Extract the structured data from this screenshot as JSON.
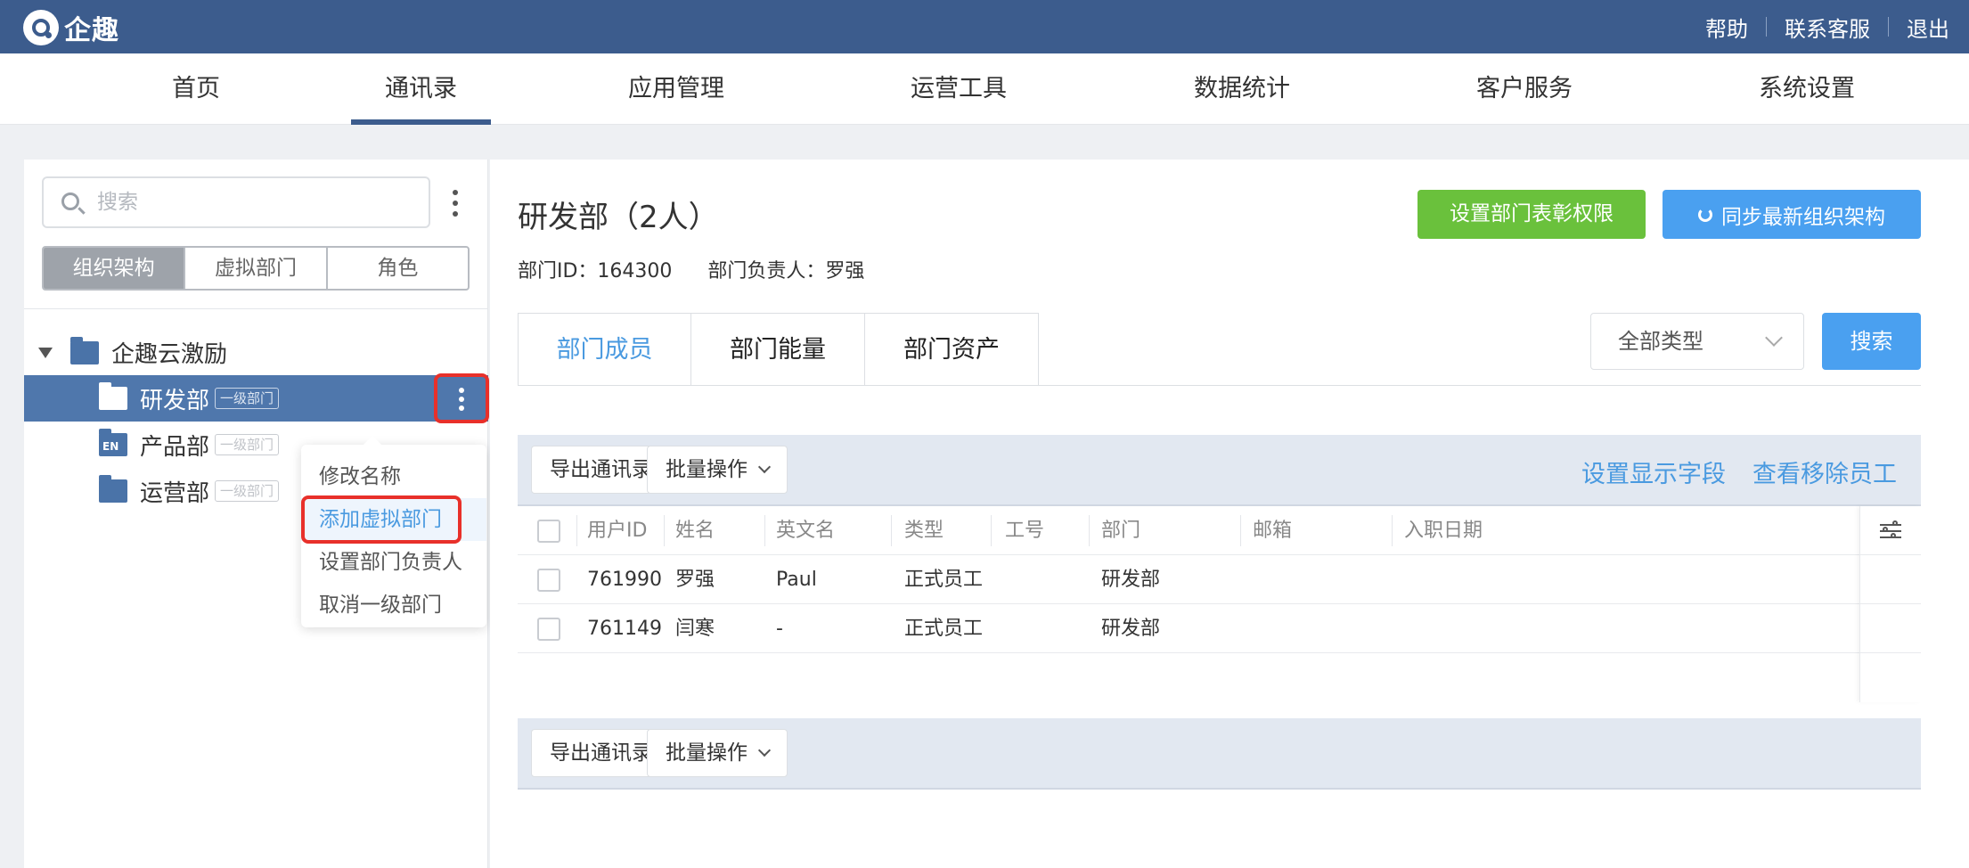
{
  "header": {
    "logo_text": "企趣",
    "links": [
      "帮助",
      "联系客服",
      "退出"
    ]
  },
  "nav": {
    "items": [
      "首页",
      "通讯录",
      "应用管理",
      "运营工具",
      "数据统计",
      "客户服务",
      "系统设置"
    ],
    "active": "通讯录"
  },
  "sidebar": {
    "search_placeholder": "搜索",
    "segments": [
      "组织架构",
      "虚拟部门",
      "角色"
    ],
    "active_segment": "组织架构",
    "tree": {
      "root": "企趣云激励",
      "children": [
        {
          "label": "研发部",
          "tag": "一级部门",
          "selected": true
        },
        {
          "label": "产品部",
          "tag": "一级部门",
          "icon": "EN"
        },
        {
          "label": "运营部",
          "tag": "一级部门"
        }
      ]
    },
    "context_menu": [
      "修改名称",
      "添加虚拟部门",
      "设置部门负责人",
      "取消一级部门"
    ],
    "context_menu_highlight": "添加虚拟部门"
  },
  "main": {
    "title": "研发部（2人）",
    "dept_id": "部门ID：164300",
    "manager": "部门负责人：罗强",
    "btn_reward": "设置部门表彰权限",
    "btn_sync": "同步最新组织架构",
    "tabs": [
      "部门成员",
      "部门能量",
      "部门资产"
    ],
    "type_select": "全部类型",
    "search_btn": "搜索",
    "toolbar": {
      "export": "导出通讯录",
      "batch": "批量操作",
      "set_fields": "设置显示字段",
      "view_removed": "查看移除员工"
    },
    "table": {
      "columns": [
        "用户ID",
        "姓名",
        "英文名",
        "类型",
        "工号",
        "部门",
        "邮箱",
        "入职日期"
      ],
      "rows": [
        [
          "761990",
          "罗强",
          "Paul",
          "正式员工",
          "",
          "研发部",
          "",
          ""
        ],
        [
          "761149",
          "闫寒",
          "-",
          "正式员工",
          "",
          "研发部",
          "",
          ""
        ]
      ]
    }
  },
  "colors": {
    "header_bg": "#3c5c8d",
    "selected_row": "#4f77ac",
    "primary_blue": "#4aa0f0",
    "green": "#6ac13c",
    "highlight_red": "#e8302a"
  }
}
